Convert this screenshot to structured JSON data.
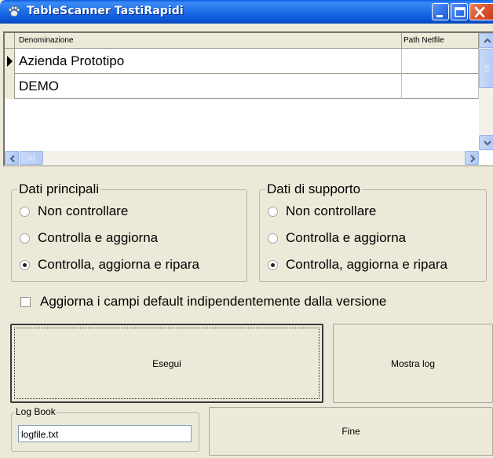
{
  "window": {
    "title": "TableScanner TastiRapidi",
    "title_color": "#ffffff",
    "titlebar_color": "#1f6fe8"
  },
  "grid": {
    "columns": [
      "Denominazione",
      "Path Netfile"
    ],
    "rows": [
      {
        "denominazione": "Azienda Prototipo",
        "path_netfile": "",
        "current": true
      },
      {
        "denominazione": "DEMO",
        "path_netfile": "",
        "current": false
      }
    ]
  },
  "dati_principali": {
    "title": "Dati principali",
    "options": [
      {
        "label": "Non controllare",
        "selected": false
      },
      {
        "label": "Controlla e aggiorna",
        "selected": false
      },
      {
        "label": "Controlla, aggiorna e ripara",
        "selected": true
      }
    ]
  },
  "dati_supporto": {
    "title": "Dati di supporto",
    "options": [
      {
        "label": "Non controllare",
        "selected": false
      },
      {
        "label": "Controlla e aggiorna",
        "selected": false
      },
      {
        "label": "Controlla, aggiorna e ripara",
        "selected": true
      }
    ]
  },
  "aggiorna_default": {
    "label": "Aggiorna i campi default indipendentemente dalla versione",
    "checked": false
  },
  "buttons": {
    "esegui": "Esegui",
    "mostra_log": "Mostra log",
    "fine": "Fine"
  },
  "log_book": {
    "title": "Log Book",
    "value": "logfile.txt"
  },
  "icons": {
    "app": "cat-paw-icon",
    "minimize": "minimize-icon",
    "maximize": "maximize-icon",
    "close": "close-icon"
  }
}
